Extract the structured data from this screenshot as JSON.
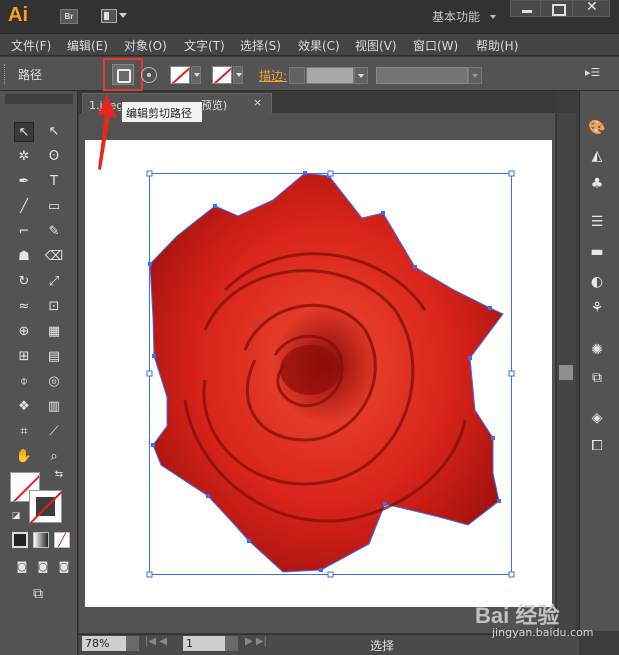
{
  "app": {
    "logo": "Ai",
    "bridge_label": "Br",
    "workspace": "基本功能"
  },
  "menu": [
    "文件(F)",
    "编辑(E)",
    "对象(O)",
    "文字(T)",
    "选择(S)",
    "效果(C)",
    "视图(V)",
    "窗口(W)",
    "帮助(H)"
  ],
  "control": {
    "selection_label": "路径",
    "stroke_label": "描边:",
    "stroke_value": ""
  },
  "tooltip": {
    "text": "编辑剪切路径"
  },
  "document": {
    "tab_title": "1.jpeg @ 78% (RGB/预览)",
    "close_glyph": "×"
  },
  "status": {
    "zoom": "78%",
    "page": "1",
    "tool_status": "选择"
  },
  "watermark": {
    "brand": "Bai 经验",
    "url": "jingyan.baidu.com"
  },
  "colors": {
    "accent": "#f7a01b",
    "highlight": "#e03b32",
    "selection": "#3b6bff",
    "rose": "#d8231a"
  },
  "icons": {
    "tools": [
      "selection-arrow-icon",
      "direct-selection-icon",
      "magic-wand-icon",
      "lasso-icon",
      "pen-icon",
      "type-icon",
      "line-icon",
      "rectangle-icon",
      "paintbrush-icon",
      "pencil-icon",
      "blob-brush-icon",
      "eraser-icon",
      "rotate-icon",
      "scale-icon",
      "width-icon",
      "free-transform-icon",
      "shape-builder-icon",
      "perspective-grid-icon",
      "mesh-icon",
      "gradient-icon",
      "eyedropper-icon",
      "blend-icon",
      "symbol-sprayer-icon",
      "column-graph-icon",
      "artboard-icon",
      "slice-icon",
      "hand-icon",
      "zoom-icon"
    ],
    "panels": [
      "color-icon",
      "color-guide-icon",
      "swatches-icon",
      "stroke-icon",
      "gradient-panel-icon",
      "transparency-icon",
      "brushes-icon",
      "appearance-icon",
      "graphic-styles-icon",
      "layers-icon",
      "artboards-icon"
    ]
  }
}
